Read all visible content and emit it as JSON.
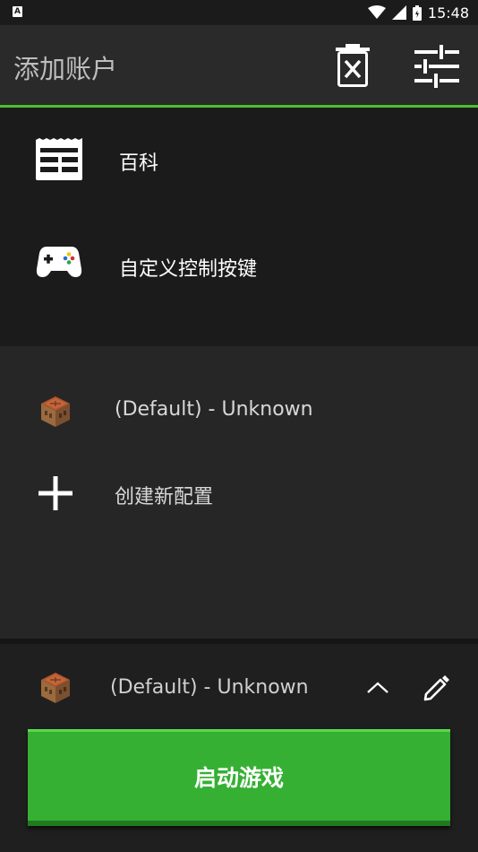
{
  "status_bar": {
    "time": "15:48",
    "app_icon_letter": "A",
    "icons": [
      "wifi-icon",
      "cell-signal-icon",
      "battery-icon"
    ]
  },
  "app_bar": {
    "title": "添加账户",
    "actions": [
      "delete-account-icon",
      "settings-sliders-icon"
    ],
    "accent_color": "#4cbf33"
  },
  "menu": {
    "items": [
      {
        "label": "百科",
        "icon": "news-icon"
      },
      {
        "label": "自定义控制按键",
        "icon": "gamepad-icon"
      }
    ]
  },
  "profiles": {
    "items": [
      {
        "label": "(Default) - Unknown",
        "icon": "crafting-table-icon"
      },
      {
        "label": "创建新配置",
        "icon": "plus-icon"
      }
    ]
  },
  "selected_profile": {
    "label": "(Default) - Unknown",
    "icon": "crafting-table-icon"
  },
  "launch_button": {
    "label": "启动游戏",
    "color": "#35b033"
  }
}
